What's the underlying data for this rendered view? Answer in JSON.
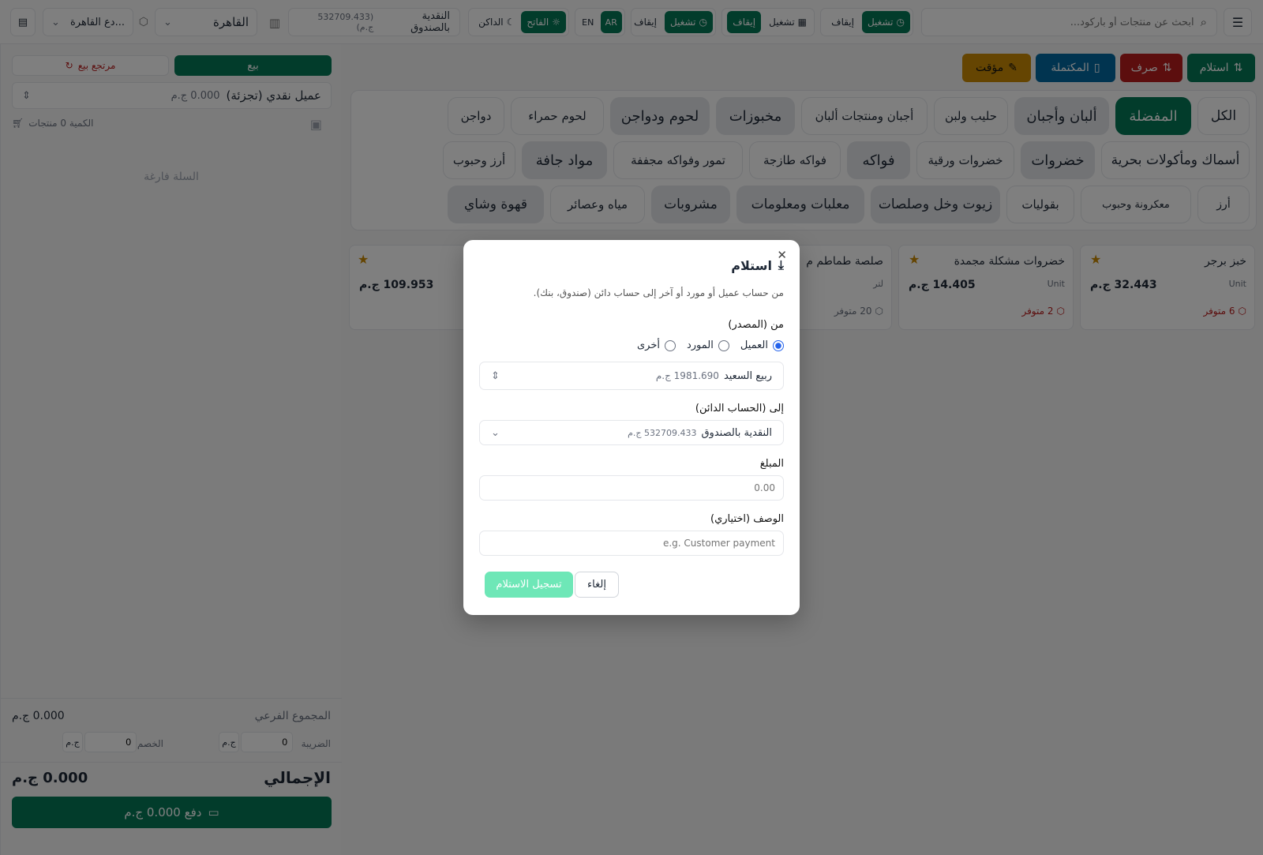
{
  "topbar": {
    "menu_icon": "hamburger-icon",
    "search_placeholder": "ابحث عن منتجات أو باركود...",
    "group1": {
      "active": "تشغيل",
      "other": "إيقاف"
    },
    "group2": {
      "active": "إيقاف",
      "other": "تشغيل"
    },
    "group3": {
      "active": "تشغيل",
      "other": "إيقاف"
    },
    "lang": {
      "ar": "AR",
      "en": "EN"
    },
    "theme": {
      "light": "الفاتح",
      "dark": "الداكن"
    },
    "cash": {
      "label": "النقدية بالصندوق",
      "amount": "(532709.433 ج.م)"
    },
    "branch": "القاهرة",
    "warehouse": "...دع القاهرة"
  },
  "actions": {
    "receive": "استلام",
    "spend": "صرف",
    "completed": "المكتملة",
    "temp": "مؤقت"
  },
  "categories": {
    "row1": [
      "الكل",
      "المفضلة",
      "ألبان وأجبان",
      "حليب ولبن",
      "أجبان ومنتجات ألبان",
      "مخبوزات",
      "لحوم ودواجن",
      "لحوم حمراء",
      "دواجن"
    ],
    "row2": [
      "أسماك ومأكولات بحرية",
      "خضروات",
      "خضروات ورقية",
      "فواكه",
      "فواكه طازجة",
      "تمور وفواكه مجففة",
      "مواد جافة",
      "أرز وحبوب"
    ],
    "row3": [
      "أرز",
      "معكرونة وحبوب",
      "بقوليات",
      "زيوت وخل وصلصات",
      "معلبات ومعلومات",
      "مشروبات",
      "مياه وعصائر",
      "قهوة وشاي"
    ]
  },
  "products": [
    {
      "name": "خبز برجر",
      "unit": "Unit",
      "price": "32.443 ج.م",
      "stock": "6 متوفر",
      "low": true
    },
    {
      "name": "خضروات مشكلة مجمدة",
      "unit": "Unit",
      "price": "14.405 ج.م",
      "stock": "2 متوفر",
      "low": true
    },
    {
      "name": "صلصة طماطم م",
      "unit": "لتر",
      "price": "",
      "stock": "20 متوفر",
      "low": false
    },
    {
      "name": "",
      "unit": "",
      "price": "109.953 ج.م",
      "stock": "",
      "low": false
    }
  ],
  "cart": {
    "sale": "بيع",
    "return": "مرتجع بيع",
    "customer": "عميل نقدي (تجزئة)",
    "customer_balance": "0.000 ج.م",
    "qty": "الكمية 0 منتجات",
    "empty": "السلة فارغة",
    "subtotal_label": "المجموع الفرعي",
    "subtotal": "0.000 ج.م",
    "tax_label": "الضريبة",
    "tax": "0",
    "tax_unit": "ج.م",
    "discount_label": "الخصم",
    "discount": "0",
    "discount_unit": "ج.م",
    "total_label": "الإجمالي",
    "total": "0.000 ج.م",
    "pay": "دفع 0.000 ج.م"
  },
  "modal": {
    "title": "استلام",
    "desc": "من حساب عميل أو مورد أو آخر إلى حساب دائن (صندوق، بنك).",
    "from_label": "من (المصدر)",
    "radios": {
      "customer": "العميل",
      "supplier": "المورد",
      "other": "أخرى"
    },
    "selected_radio": "customer",
    "source_name": "ربيع السعيد",
    "source_amount": "1981.690 ج.م",
    "to_label": "إلى (الحساب الدائن)",
    "to_name": "النقدية بالصندوق",
    "to_amount": "532709.433 ج.م",
    "amount_label": "المبلغ",
    "amount_placeholder": "0.00",
    "desc_label": "الوصف (اختياري)",
    "desc_placeholder": "e.g. Customer payment",
    "cancel": "إلغاء",
    "submit": "تسجيل الاستلام"
  },
  "colors": {
    "primary": "#047857",
    "danger": "#b91c1c",
    "info": "#0369a1",
    "warning": "#ca8a04",
    "submit_disabled": "#6ee7b7"
  }
}
